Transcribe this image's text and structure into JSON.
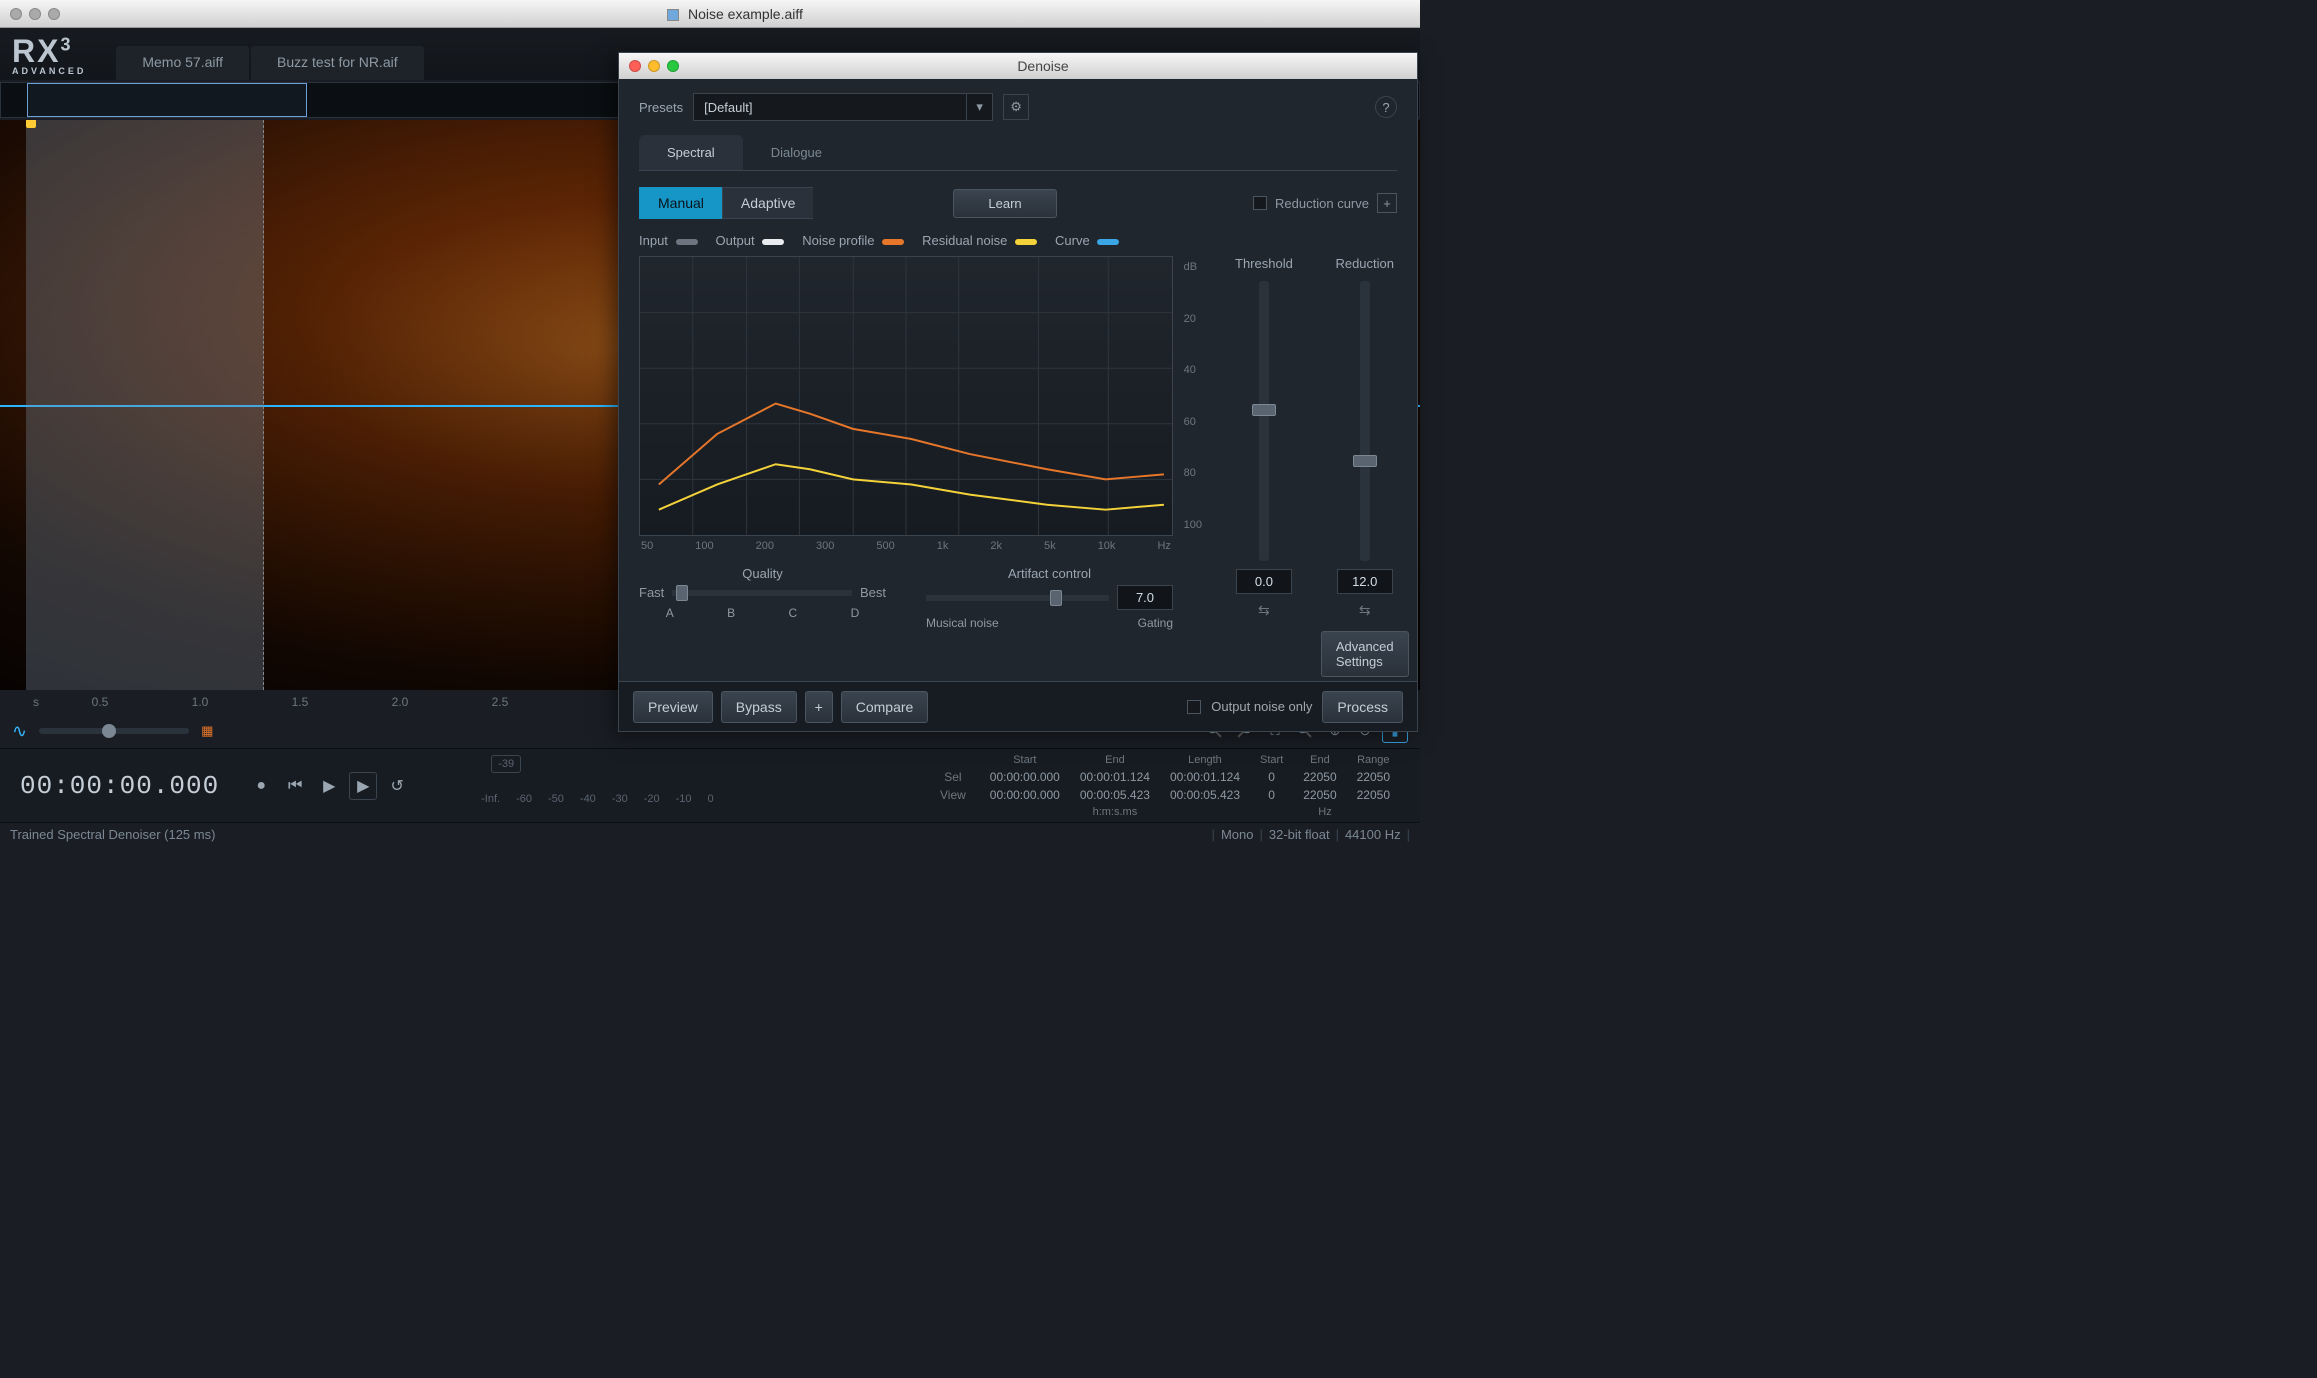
{
  "outer_window": {
    "title": "Noise example.aiff"
  },
  "app": {
    "logo_text": "RX",
    "logo_sup": "3",
    "logo_sub": "ADVANCED"
  },
  "file_tabs": [
    {
      "label": "Memo 57.aiff",
      "active": false
    },
    {
      "label": "Buzz test for NR.aif",
      "active": false
    }
  ],
  "time_axis": {
    "unit": "s",
    "ticks": [
      "0.5",
      "1.0",
      "1.5",
      "2.0",
      "2.5"
    ]
  },
  "transport": {
    "timecode": "00:00:00.000",
    "db_ticks": [
      "-Inf.",
      "-60",
      "-50",
      "-40",
      "-30",
      "-20",
      "-10",
      "0"
    ],
    "peak_display": "-39"
  },
  "selview": {
    "headers": [
      "Start",
      "End",
      "Length",
      "Start",
      "End",
      "Range"
    ],
    "rows": {
      "Sel": [
        "00:00:00.000",
        "00:00:01.124",
        "00:00:01.124",
        "0",
        "22050",
        "22050"
      ],
      "View": [
        "00:00:00.000",
        "00:00:05.423",
        "00:00:05.423",
        "0",
        "22050",
        "22050"
      ]
    },
    "unit_left": "h:m:s.ms",
    "unit_right": "Hz"
  },
  "statusbar": {
    "left": "Trained Spectral Denoiser (125 ms)",
    "right": [
      "Mono",
      "32-bit float",
      "44100 Hz"
    ]
  },
  "denoise": {
    "window_title": "Denoise",
    "presets_label": "Presets",
    "preset_value": "[Default]",
    "tabs": [
      {
        "label": "Spectral",
        "active": true
      },
      {
        "label": "Dialogue",
        "active": false
      }
    ],
    "modes": [
      {
        "label": "Manual",
        "active": true
      },
      {
        "label": "Adaptive",
        "active": false
      }
    ],
    "learn_label": "Learn",
    "reduction_curve_label": "Reduction curve",
    "legend": {
      "input": "Input",
      "output": "Output",
      "noise_profile": "Noise profile",
      "residual_noise": "Residual noise",
      "curve": "Curve"
    },
    "y_ticks": [
      "dB",
      "20",
      "40",
      "60",
      "80",
      "100"
    ],
    "x_ticks": [
      "50",
      "100",
      "200",
      "300",
      "500",
      "1k",
      "2k",
      "5k",
      "10k",
      "Hz"
    ],
    "threshold_label": "Threshold",
    "threshold_value": "0.0",
    "reduction_label": "Reduction",
    "reduction_value": "12.0",
    "quality": {
      "title": "Quality",
      "left": "Fast",
      "right": "Best",
      "letters": [
        "A",
        "B",
        "C",
        "D"
      ]
    },
    "artifact": {
      "title": "Artifact control",
      "left": "Musical noise",
      "right": "Gating",
      "value": "7.0"
    },
    "advanced_label": "Advanced Settings",
    "bottom": {
      "preview": "Preview",
      "bypass": "Bypass",
      "compare": "Compare",
      "output_noise_only": "Output noise only",
      "process": "Process"
    }
  },
  "chart_data": {
    "type": "line",
    "xlabel": "Hz",
    "ylabel": "dB",
    "x_scale": "log",
    "ylim": [
      -110,
      0
    ],
    "x_ticks": [
      50,
      100,
      200,
      300,
      500,
      1000,
      2000,
      5000,
      10000
    ],
    "series": [
      {
        "name": "Noise profile",
        "color": "#e6762a",
        "x": [
          50,
          100,
          200,
          300,
          500,
          1000,
          2000,
          5000,
          10000,
          20000
        ],
        "y": [
          -90,
          -70,
          -58,
          -62,
          -68,
          -72,
          -78,
          -84,
          -88,
          -86
        ]
      },
      {
        "name": "Residual noise",
        "color": "#f3d23a",
        "x": [
          50,
          100,
          200,
          300,
          500,
          1000,
          2000,
          5000,
          10000,
          20000
        ],
        "y": [
          -100,
          -90,
          -82,
          -84,
          -88,
          -90,
          -94,
          -98,
          -100,
          -98
        ]
      }
    ]
  }
}
